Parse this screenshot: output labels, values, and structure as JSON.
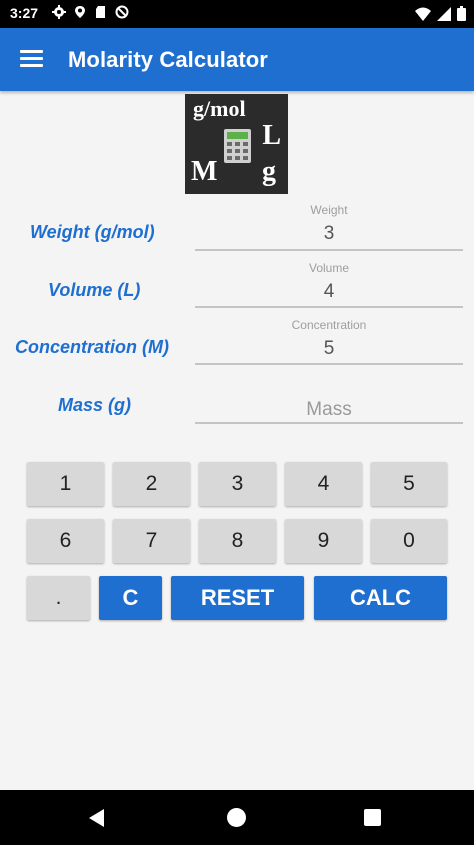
{
  "status_bar": {
    "time": "3:27",
    "left_icons": [
      "settings-icon",
      "location-icon",
      "sd-card-icon",
      "blocked-icon"
    ],
    "right_icons": [
      "wifi-icon",
      "signal-icon",
      "battery-icon"
    ]
  },
  "app_bar": {
    "title": "Molarity Calculator",
    "menu_icon": "menu-icon"
  },
  "logo": {
    "gmol": "g/mol",
    "L": "L",
    "M": "M",
    "g": "g"
  },
  "fields": {
    "weight": {
      "label": "Weight (g/mol)",
      "hint": "Weight",
      "value": "3"
    },
    "volume": {
      "label": "Volume (L)",
      "hint": "Volume",
      "value": "4"
    },
    "concentration": {
      "label": "Concentration (M)",
      "hint": "Concentration",
      "value": "5"
    },
    "mass": {
      "label": "Mass (g)",
      "placeholder": "Mass"
    }
  },
  "keypad": {
    "row1": [
      "1",
      "2",
      "3",
      "4",
      "5"
    ],
    "row2": [
      "6",
      "7",
      "8",
      "9",
      "0"
    ],
    "dot": ".",
    "clear": "C",
    "reset": "RESET",
    "calc": "CALC"
  },
  "colors": {
    "primary": "#1f6fd1",
    "key_gray": "#d8d8d8",
    "background": "#f4f4f4"
  },
  "nav_bar": {
    "icons": [
      "back-icon",
      "home-icon",
      "recents-icon"
    ]
  }
}
